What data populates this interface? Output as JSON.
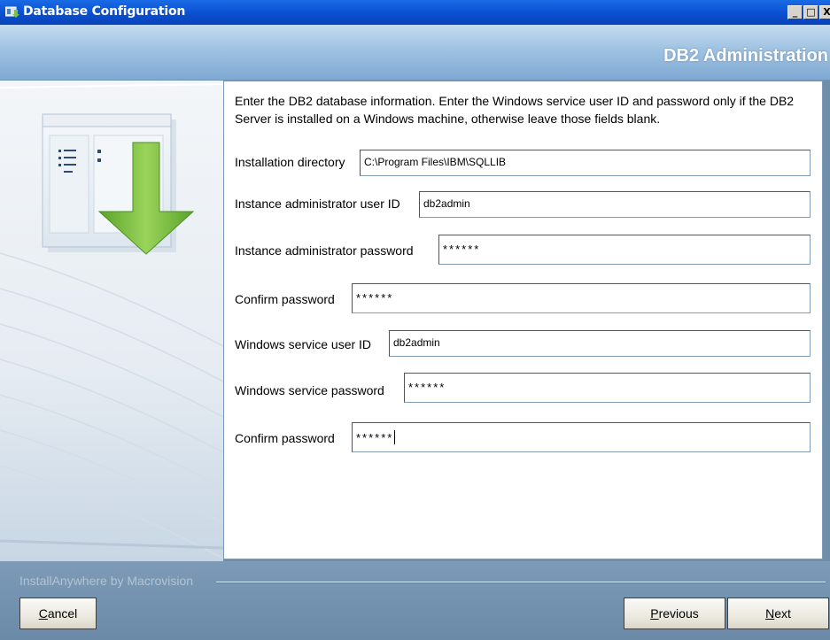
{
  "window": {
    "title": "Database Configuration",
    "icon": "installer-app-icon",
    "controls": {
      "minimize": "_",
      "maximize": "□",
      "close": "X"
    }
  },
  "banner": {
    "heading": "DB2 Administration"
  },
  "illustration": {
    "icon": "database-download-arrow-icon"
  },
  "instructions": "Enter the DB2 database information.  Enter the Windows service user ID and password only if the DB2 Server is installed on a Windows machine, otherwise leave those fields blank.",
  "fields": {
    "install_dir": {
      "label": "Installation directory",
      "value": "C:\\Program Files\\IBM\\SQLLIB"
    },
    "admin_user": {
      "label": "Instance administrator user ID",
      "value": "db2admin"
    },
    "admin_password": {
      "label": "Instance administrator password",
      "value": "******"
    },
    "confirm_password_1": {
      "label": "Confirm password",
      "value": "******"
    },
    "service_user": {
      "label": "Windows service user ID",
      "value": "db2admin"
    },
    "service_password": {
      "label": "Windows service password",
      "value": "******"
    },
    "confirm_password_2": {
      "label": "Confirm password",
      "value": "******"
    }
  },
  "footer": {
    "brand": "InstallAnywhere by Macrovision",
    "cancel": {
      "mnemonic": "C",
      "rest": "ancel"
    },
    "previous": {
      "mnemonic": "P",
      "rest": "revious"
    },
    "next": {
      "mnemonic": "N",
      "rest": "ext"
    }
  },
  "colors": {
    "titlebar": "#0a4fd0",
    "banner": "#9fc2e2",
    "footer": "#6a8aa8",
    "arrow": "#7cc242"
  }
}
